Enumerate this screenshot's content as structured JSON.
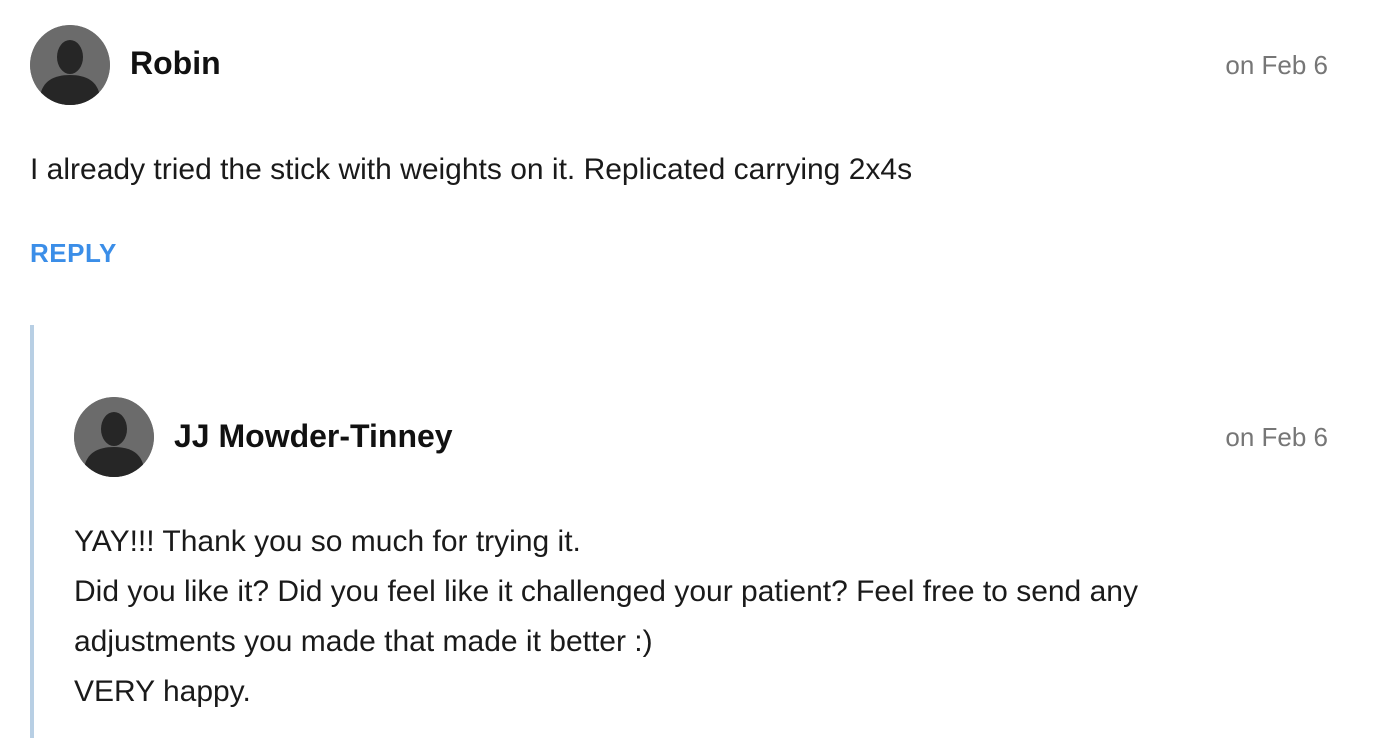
{
  "comments": [
    {
      "author": "Robin",
      "date": "on Feb 6",
      "avatar_icon": "default-user-silhouette-icon",
      "body": [
        "I already tried the stick with weights on it. Replicated carrying 2x4s"
      ],
      "reply_label": "REPLY"
    },
    {
      "author": "JJ Mowder-Tinney",
      "date": "on Feb 6",
      "avatar_icon": "default-user-silhouette-icon",
      "body": [
        "YAY!!! Thank you so much for trying it.",
        "Did you like it? Did you feel like it challenged your patient? Feel free to send any",
        "adjustments you made that made it better :)",
        "VERY happy."
      ]
    }
  ],
  "colors": {
    "reply_link": "#3b8ee8",
    "thread_line": "#b8cfe4",
    "avatar_bg": "#6b6b6b",
    "date_text": "#767676"
  }
}
